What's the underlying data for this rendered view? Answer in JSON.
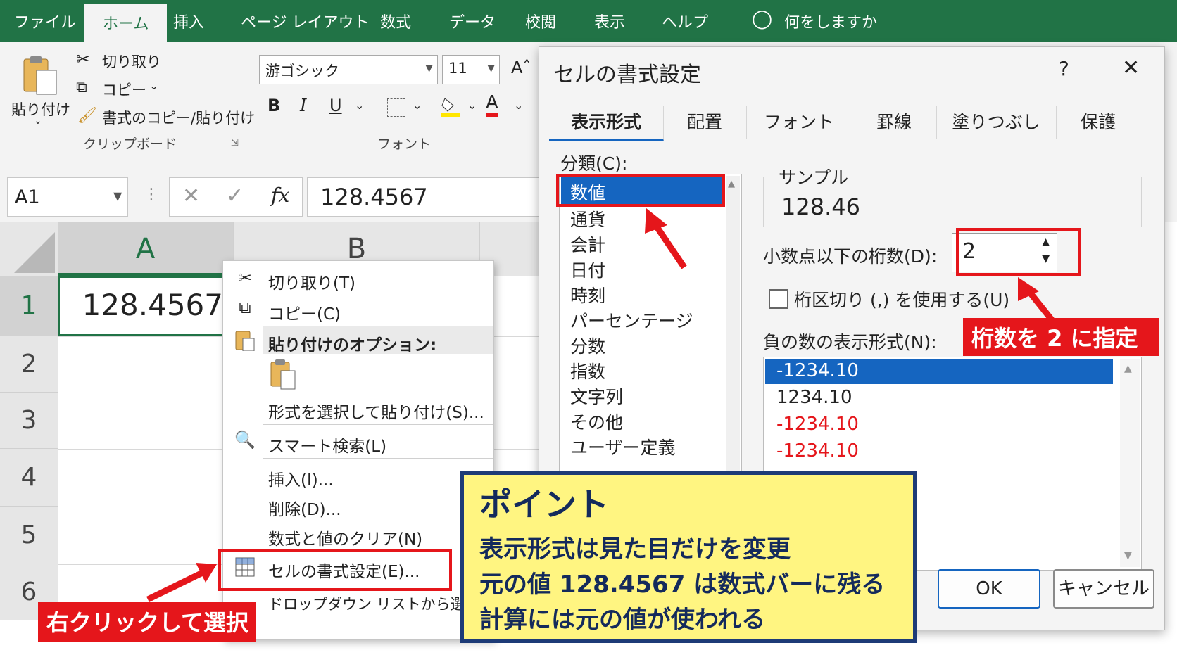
{
  "ribbon": {
    "tabs": [
      "ファイル",
      "ホーム",
      "挿入",
      "ページ レイアウト",
      "数式",
      "データ",
      "校閲",
      "表示",
      "ヘルプ"
    ],
    "active_tab": "ホーム",
    "tell_me": "何をしますか",
    "paste_label": "貼り付け",
    "cut_label": "切り取り",
    "copy_label": "コピー",
    "format_painter_label": "書式のコピー/貼り付け",
    "clipboard_group": "クリップボード",
    "font_name": "游ゴシック",
    "font_size": "11",
    "bold": "B",
    "italic": "I",
    "underline": "U",
    "font_group": "フォント",
    "font_color_glyph": "A"
  },
  "formula_bar": {
    "name_box": "A1",
    "fx": "fx",
    "value": "128.4567"
  },
  "sheet": {
    "columns": [
      "A",
      "B"
    ],
    "rows": [
      "1",
      "2",
      "3",
      "4",
      "5",
      "6"
    ],
    "cell_a1": "128.4567"
  },
  "context_menu": {
    "cut": "切り取り(T)",
    "copy": "コピー(C)",
    "paste_options": "貼り付けのオプション:",
    "paste_special": "形式を選択して貼り付け(S)...",
    "smart_lookup": "スマート検索(L)",
    "insert": "挿入(I)...",
    "delete": "削除(D)...",
    "clear_contents": "数式と値のクリア(N)",
    "format_cells": "セルの書式設定(E)...",
    "pick_from_list": "ドロップダウン リストから選択(K)..."
  },
  "dialog": {
    "title": "セルの書式設定",
    "help": "?",
    "close": "✕",
    "tabs": [
      "表示形式",
      "配置",
      "フォント",
      "罫線",
      "塗りつぶし",
      "保護"
    ],
    "active_tab": "表示形式",
    "category_label": "分類(C):",
    "categories": [
      "数値",
      "通貨",
      "会計",
      "日付",
      "時刻",
      "パーセンテージ",
      "分数",
      "指数",
      "文字列",
      "その他",
      "ユーザー定義"
    ],
    "selected_category": "数値",
    "sample_label": "サンプル",
    "sample_value": "128.46",
    "decimal_label": "小数点以下の桁数(D):",
    "decimal_value": "2",
    "separator_label": "桁区切り (,) を使用する(U)",
    "negative_label": "負の数の表示形式(N):",
    "negative_formats": [
      "-1234.10",
      "1234.10",
      "-1234.10",
      "-1234.10"
    ],
    "ok": "OK",
    "cancel": "キャンセル"
  },
  "annotations": {
    "right_click_label": "右クリックして選択",
    "decimal_note": "桁数を 2 に指定",
    "point_title": "ポイント",
    "point_lines": [
      "表示形式は見た目だけを変更",
      "元の値 128.4567 は数式バーに残る",
      "計算には元の値が使われる"
    ]
  },
  "colors": {
    "excel_green": "#217346",
    "selection_blue": "#1565c0",
    "annotation_red": "#e5161b",
    "note_yellow": "#fff581",
    "note_border": "#1d3b77"
  }
}
